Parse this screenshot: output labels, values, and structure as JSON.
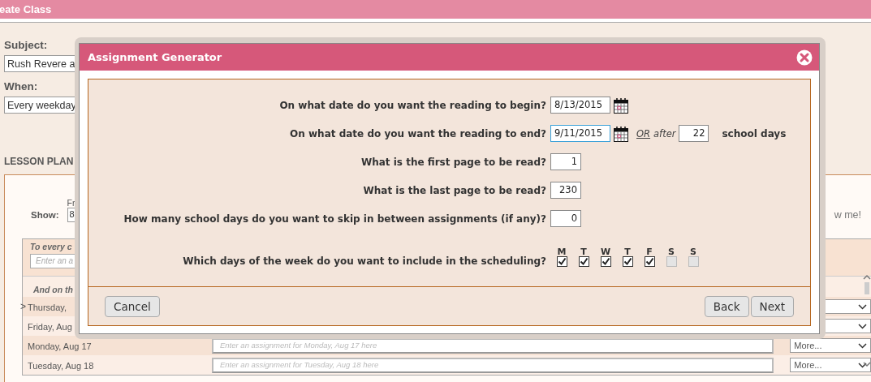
{
  "page": {
    "title": "eate Class",
    "subject": {
      "label": "Subject:",
      "value": "Rush Revere a"
    },
    "when": {
      "label": "When:",
      "value": "Every weekday"
    },
    "lesson_plan": {
      "heading": "LESSON PLAN",
      "show_label": "Show:",
      "from_label": "Fr",
      "from_value": "8",
      "show_me": "w me!",
      "every_day": {
        "heading": "To every c",
        "placeholder": "Enter an a"
      },
      "specific_heading": "And on th",
      "days": [
        {
          "marker": ">",
          "label": "Thursday,"
        },
        {
          "label": "Friday, Aug"
        },
        {
          "label": "Monday, Aug 17",
          "placeholder": "Enter an assignment for Monday, Aug 17 here",
          "more": "More..."
        },
        {
          "label": "Tuesday, Aug 18",
          "placeholder": "Enter an assignment for Tuesday, Aug 18 here",
          "more": "More..."
        }
      ]
    }
  },
  "dialog": {
    "title": "Assignment Generator",
    "questions": [
      {
        "kind": "date",
        "label": "On what date do you want the reading to begin?",
        "value": "8/13/2015",
        "focused": false
      },
      {
        "kind": "date",
        "label": "On what date do you want the reading to end?",
        "value": "9/11/2015",
        "focused": true,
        "or_text": "OR",
        "after_text": "after",
        "days_value": "22",
        "days_suffix": "school days"
      },
      {
        "kind": "number",
        "label": "What is the first page to be read?",
        "value": "1"
      },
      {
        "kind": "number",
        "label": "What is the last page to be read?",
        "value": "230"
      },
      {
        "kind": "number",
        "label": "How many school days do you want to skip in between assignments (if any)?",
        "value": "0"
      },
      {
        "kind": "weekdays",
        "label": "Which days of the week do you want to include in the scheduling?",
        "days": [
          {
            "letter": "M",
            "checked": true
          },
          {
            "letter": "T",
            "checked": true
          },
          {
            "letter": "W",
            "checked": true
          },
          {
            "letter": "T",
            "checked": true
          },
          {
            "letter": "F",
            "checked": true
          },
          {
            "letter": "S",
            "checked": false
          },
          {
            "letter": "S",
            "checked": false
          }
        ]
      }
    ],
    "buttons": {
      "cancel": "Cancel",
      "back": "Back",
      "next": "Next"
    }
  }
}
